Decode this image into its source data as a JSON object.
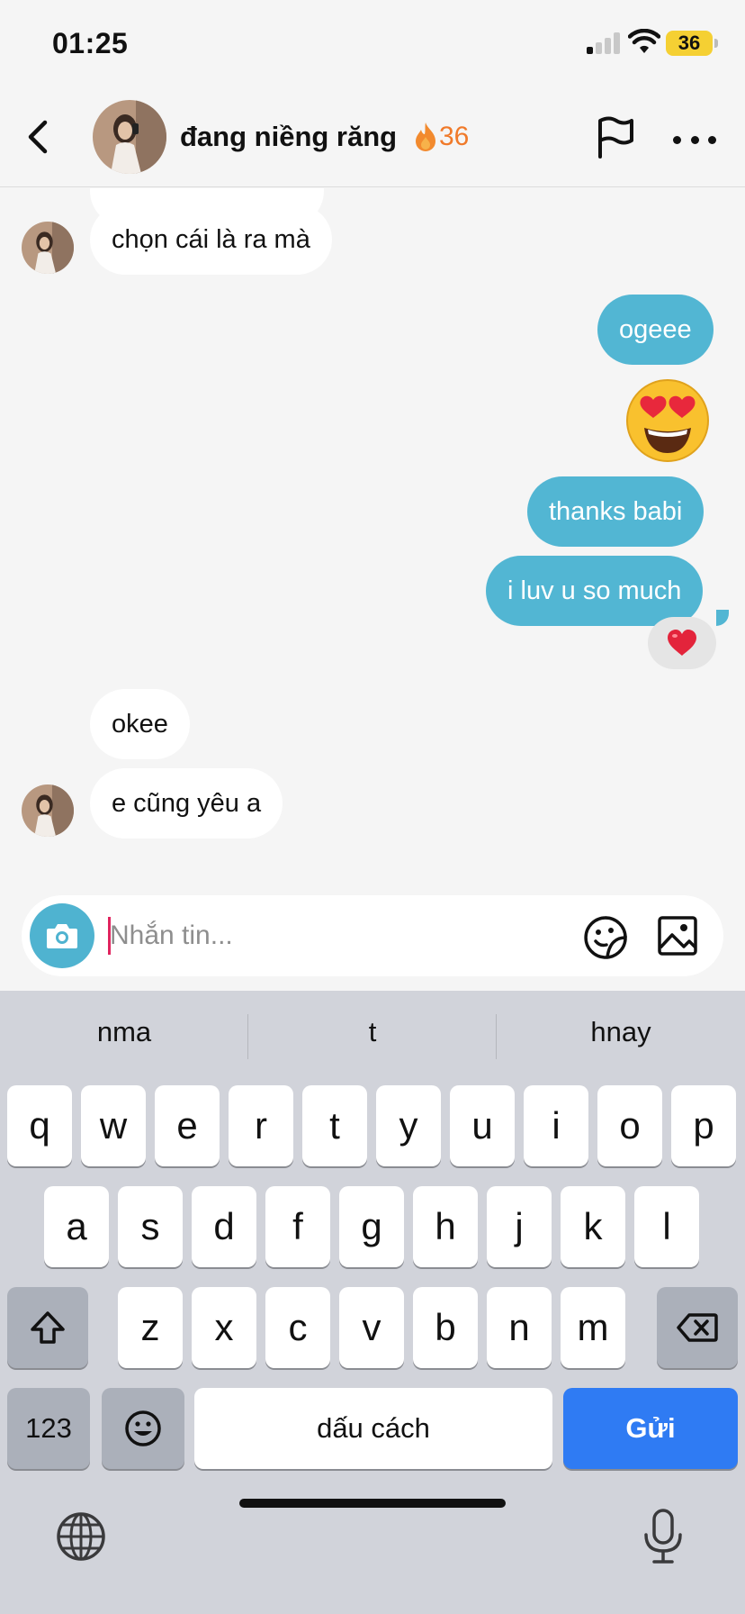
{
  "status_bar": {
    "time": "01:25",
    "battery": "36"
  },
  "header": {
    "name": "đang niềng răng",
    "streak": "36"
  },
  "messages": {
    "m1": "chọn cái là ra mà",
    "m2": "ogeee",
    "m3": "thanks babi",
    "m4": "i luv u so much",
    "m5": "okee",
    "m6": "e cũng yêu a"
  },
  "composer": {
    "placeholder": "Nhắn tin..."
  },
  "keyboard": {
    "suggestions": [
      "nma",
      "t",
      "hnay"
    ],
    "row1": [
      "q",
      "w",
      "e",
      "r",
      "t",
      "y",
      "u",
      "i",
      "o",
      "p"
    ],
    "row2": [
      "a",
      "s",
      "d",
      "f",
      "g",
      "h",
      "j",
      "k",
      "l"
    ],
    "row3": [
      "z",
      "x",
      "c",
      "v",
      "b",
      "n",
      "m"
    ],
    "numbers_label": "123",
    "space_label": "dấu cách",
    "send_label": "Gửi"
  },
  "colors": {
    "outgoing": "#52b6d3",
    "send_key": "#2f7bf3",
    "streak": "#f07a2a"
  }
}
